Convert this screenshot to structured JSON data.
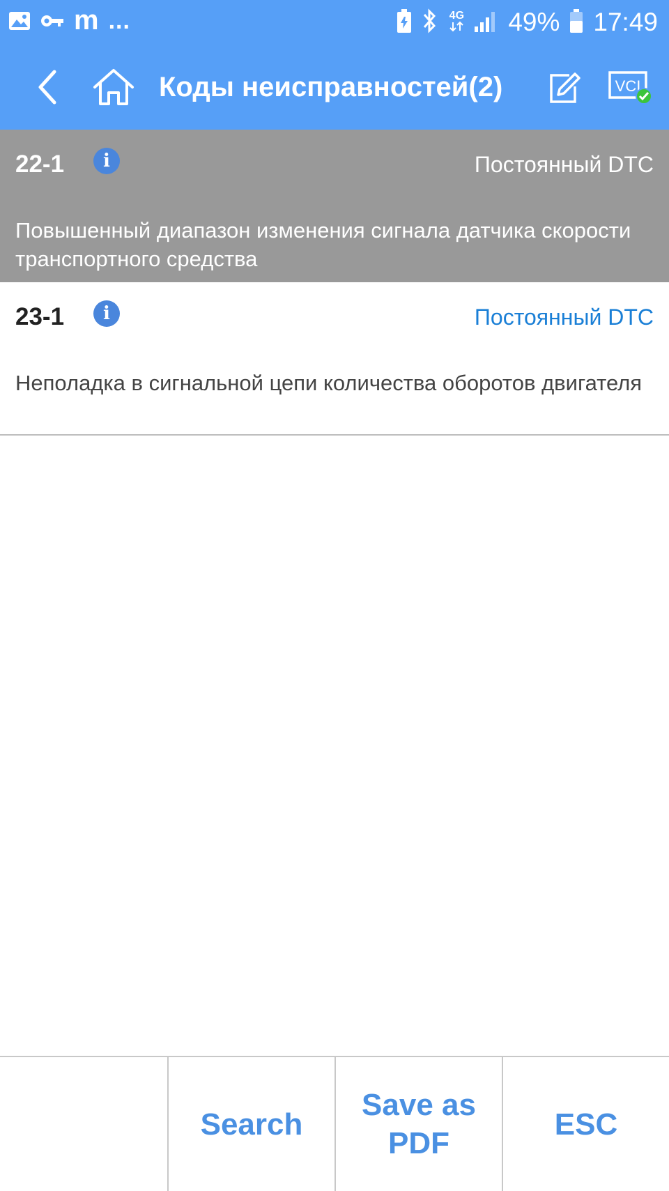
{
  "status_bar": {
    "left_text": "m",
    "more": "...",
    "network": "4G",
    "battery_percent": "49%",
    "time": "17:49"
  },
  "header": {
    "title": "Коды неисправностей(2)",
    "vci_label": "VCI"
  },
  "dtc_list": [
    {
      "code": "22-1",
      "info": "i",
      "status": "Постоянный DTC",
      "description": "Повышенный диапазон изменения сигнала датчика скорости транспортного средства",
      "selected": true
    },
    {
      "code": "23-1",
      "info": "i",
      "status": "Постоянный DTC",
      "description": "Неполадка в сигнальной цепи количества оборотов двигателя",
      "selected": false
    }
  ],
  "bottom_bar": {
    "search_label": "Search",
    "save_pdf_label": "Save as PDF",
    "esc_label": "ESC"
  },
  "colors": {
    "header_bg": "#569ff7",
    "selected_row_bg": "#999999",
    "status_blue": "#1a7fd6",
    "button_text": "#4a90e2"
  }
}
